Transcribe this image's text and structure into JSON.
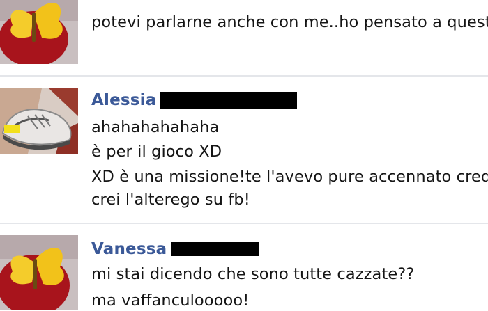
{
  "messages": [
    {
      "author": "",
      "avatar_icon": "apple-butterfly-avatar-icon",
      "lines": [
        "potevi parlarne anche con me..ho pensato a questo"
      ]
    },
    {
      "author": "Alessia",
      "author_redacted": true,
      "avatar_icon": "sneaker-avatar-icon",
      "lines": [
        "ahahahahahaha",
        "è per il gioco XD",
        "XD è una missione!te l'avevo pure accennato credo,",
        "crei l'alterego su fb!"
      ]
    },
    {
      "author": "Vanessa",
      "author_redacted": true,
      "avatar_icon": "apple-butterfly-avatar-icon",
      "lines": [
        "mi stai dicendo che sono tutte cazzate??",
        "ma vaffanculooooo!"
      ]
    }
  ],
  "colors": {
    "author_name": "#3b5998",
    "divider": "#e4e6ea",
    "text": "#151515"
  }
}
